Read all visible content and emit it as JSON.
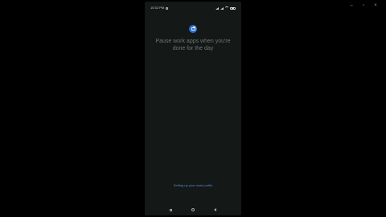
{
  "window_controls": {
    "minimize": "–",
    "maximize": "▫",
    "close": "×"
  },
  "status_bar": {
    "time": "10:32 PM",
    "battery": "46"
  },
  "message": {
    "line1": "Pause work apps when you're",
    "line2": "done for the day"
  },
  "link_text": "Setting up your work profile",
  "colors": {
    "accent": "#2f6fcf",
    "link": "#5b8bd6",
    "background": "#141817"
  },
  "icons": [
    "briefcase-icon",
    "signal-icon",
    "wifi-icon",
    "battery-icon",
    "nav-recents-icon",
    "nav-home-icon",
    "nav-back-icon"
  ]
}
